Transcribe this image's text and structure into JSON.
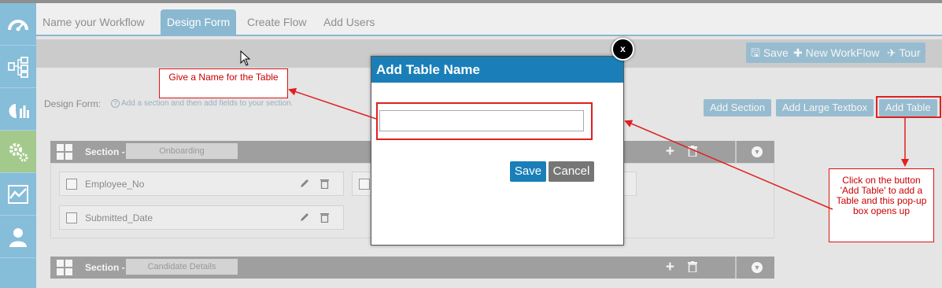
{
  "tabs": [
    {
      "label": "Name your Workflow"
    },
    {
      "label": "Design Form"
    },
    {
      "label": "Create Flow"
    },
    {
      "label": "Add Users"
    }
  ],
  "toolbar": {
    "save_label": "Save",
    "new_workflow_label": "New WorkFlow",
    "tour_label": "Tour"
  },
  "design": {
    "label": "Design Form:",
    "hint": "Add a section and then add fields to your section.",
    "hint_icon": "?"
  },
  "actions": {
    "add_section": "Add Section",
    "add_large_textbox": "Add Large Textbox",
    "add_table": "Add Table"
  },
  "sections": [
    {
      "label": "Section -",
      "name": "Onboarding",
      "fields": [
        "Employee_No",
        "Submitted_Date"
      ]
    },
    {
      "label": "Section -",
      "name": "Candidate Details"
    }
  ],
  "modal": {
    "title": "Add Table Name",
    "input_value": "",
    "save_label": "Save",
    "cancel_label": "Cancel",
    "close_label": "x"
  },
  "annotations": {
    "name_note": "Give  a Name for the Table",
    "button_note": "Click on the button 'Add Table' to add a Table and this pop-up box opens up"
  },
  "colors": {
    "accent": "#1a7fb8",
    "annotation": "#e02020",
    "sidebar": "#86bdd8",
    "active_sidebar": "#a4c98c"
  }
}
